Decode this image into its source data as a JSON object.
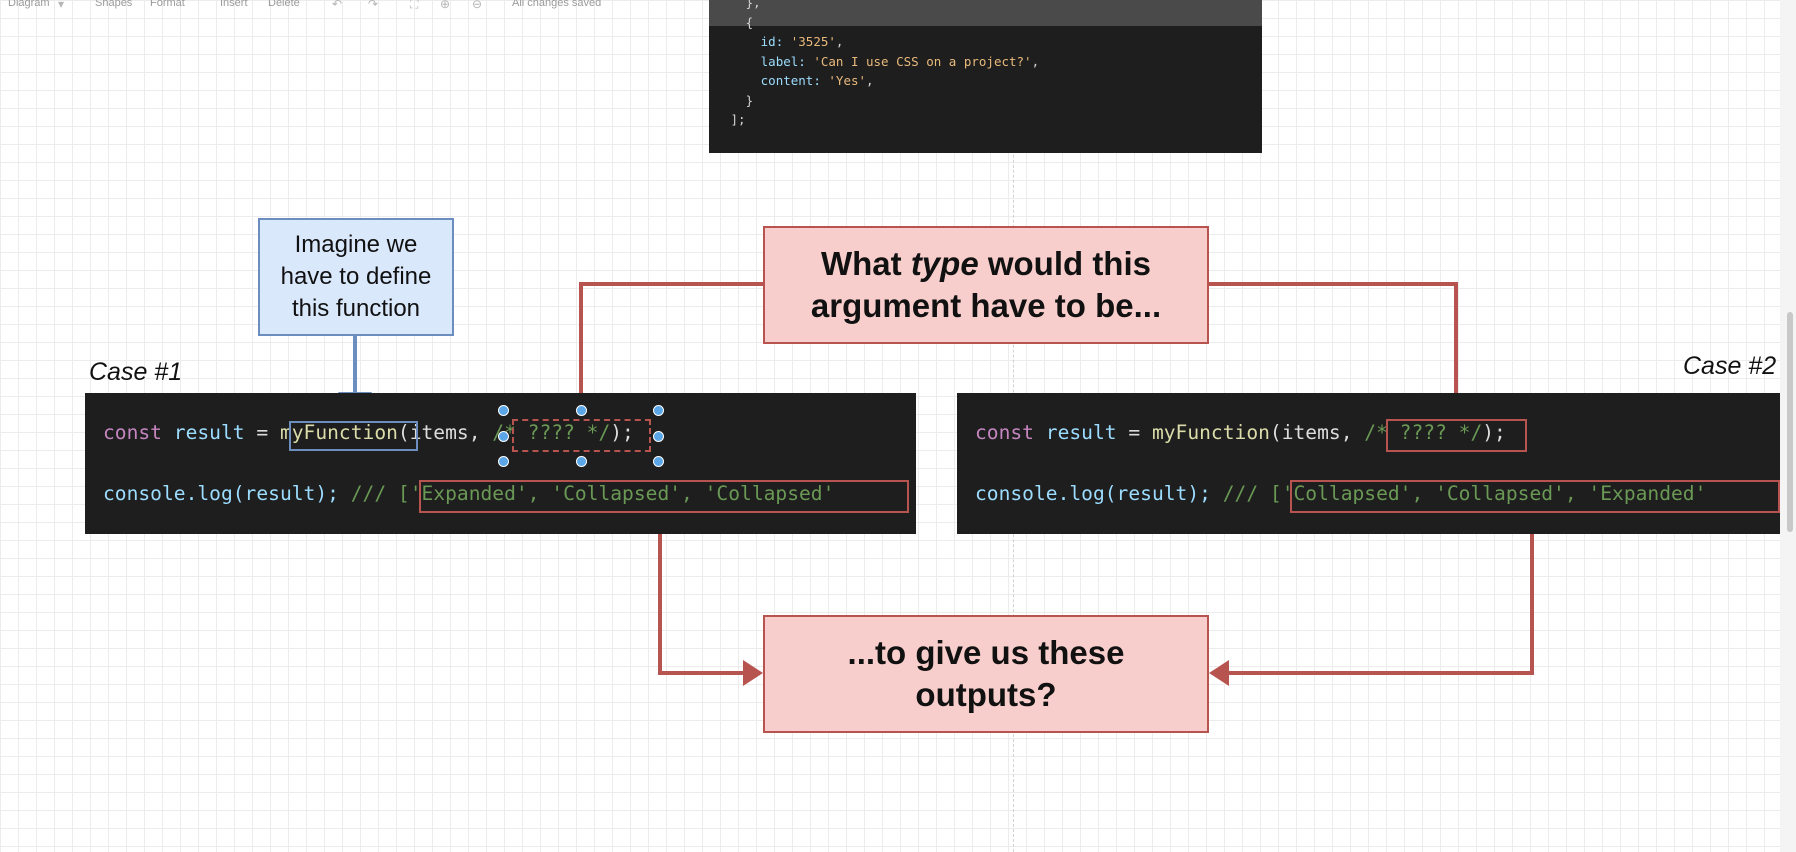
{
  "toolbar": {
    "diagram": "Diagram",
    "shapes": "Shapes",
    "format": "Format",
    "insert": "Insert",
    "delete": "Delete",
    "status": "All changes saved",
    "icons": [
      "undo-icon",
      "redo-icon",
      "fit-icon",
      "zoom-in-icon",
      "zoom-out-icon"
    ]
  },
  "top_code": {
    "line_close": "},",
    "line_open": "{",
    "id_key": "id:",
    "id_val": "'3525'",
    "label_key": "label:",
    "label_val": "'Can I use CSS on a project?'",
    "content_key": "content:",
    "content_val": "'Yes'",
    "line_close2": "}",
    "line_end": "];"
  },
  "callouts": {
    "imagine": [
      "Imagine we",
      "have to define",
      "this function"
    ],
    "what_pre": "What ",
    "what_type": "type",
    "what_post": " would this",
    "what_line2": "argument have to be...",
    "give_line1": "...to give us these",
    "give_line2": "outputs?"
  },
  "case1": {
    "label": "Case #1",
    "const_kw": "const",
    "result_var": "result",
    "eq": "=",
    "fn_name": "myFunction",
    "paren_open": "(items,",
    "arg": "/* ???? */",
    "paren_close": ");",
    "log_call": "console.log(result);",
    "comment": "///",
    "output": "['Expanded', 'Collapsed', 'Collapsed'"
  },
  "case2": {
    "label": "Case #2",
    "const_kw": "const",
    "result_var": "result",
    "eq": "=",
    "fn_name": "myFunction",
    "paren_open": "(items,",
    "arg": "/* ???? */",
    "paren_close": ");",
    "log_call": "console.log(result);",
    "comment": "///",
    "output": "['Collapsed', 'Collapsed', 'Expanded'"
  },
  "colors": {
    "red_stroke": "#b85450",
    "red_fill": "#f8cecc",
    "blue_stroke": "#6c8ebf",
    "blue_fill": "#dae8fc",
    "code_bg": "#1e1e1e"
  }
}
